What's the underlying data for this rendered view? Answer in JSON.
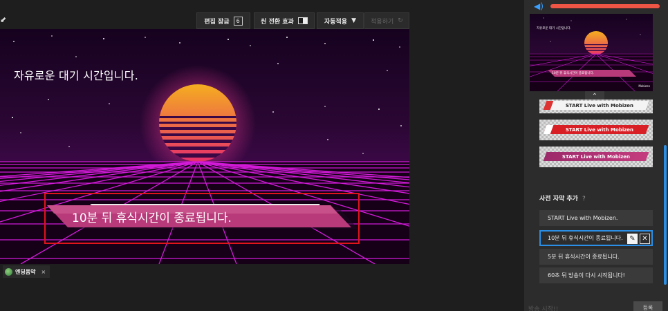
{
  "toolbar": {
    "corner_glyph": "⬋",
    "edit_lock_label": "편집 잠금",
    "edit_lock_icon": "lock-icon",
    "edit_lock_glyph": "6",
    "scene_transition_label": "씬 전환 효과",
    "auto_apply_label": "자동적용",
    "auto_apply_caret": "▼",
    "apply_label": "적용하기",
    "apply_icon": "↻"
  },
  "preview": {
    "message": "자유로운 대기 시간입니다.",
    "caption": "10분 뒤 휴식시간이 종료됩니다."
  },
  "bottom_tag": {
    "label": "엔딩음악",
    "close": "×"
  },
  "side": {
    "volume_icon": "◀)",
    "volume_color": "#ef5545",
    "thumbnail": {
      "message": "자유로운 대기 시간입니다.",
      "caption": "10분 뒤 휴식시간이 종료됩니다.",
      "brand": "Mobizen"
    },
    "collapse_glyph": "⌃",
    "lower_thirds": [
      {
        "label": "START Live with Mobizen"
      },
      {
        "label": "START Live with Mobizen"
      },
      {
        "label": "START Live with Mobizen"
      }
    ],
    "section_title": "사전 자막 추가",
    "section_help": "?",
    "captions": [
      {
        "label": "START Live with Mobizen."
      },
      {
        "label": "10분 뒤 휴식시간이 종료됩니다."
      },
      {
        "label": "5분 뒤 휴식시간이 종료됩니다."
      },
      {
        "label": "60초 뒤 방송이 다시 시작됩니다!"
      }
    ],
    "edit_glyph": "✎",
    "delete_glyph": "✕",
    "footer_label": "방송 시작!!",
    "footer_button": "등록"
  },
  "colors": {
    "accent": "#2b8fe6",
    "selection": "#e0141b",
    "sun_top": "#f5b21d",
    "sun_bottom": "#e4266f",
    "grid": "#d21bd8"
  }
}
